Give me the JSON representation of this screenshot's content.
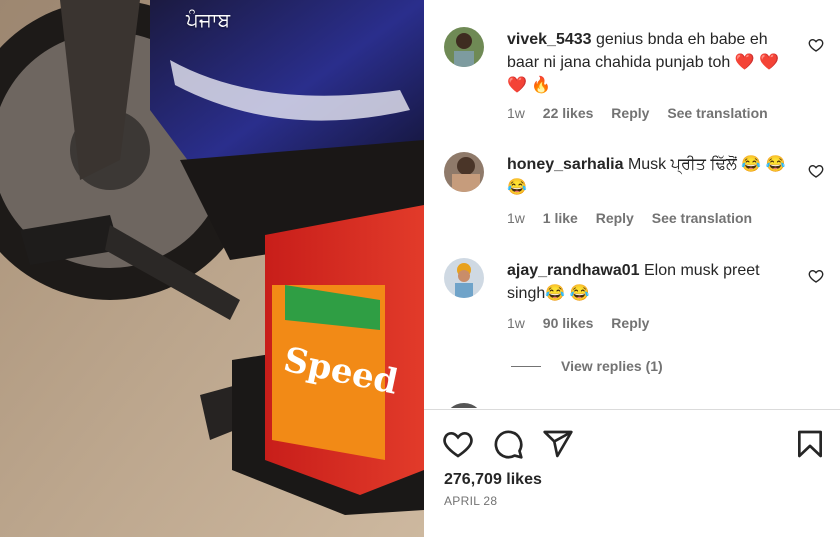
{
  "media": {
    "watermark": "ਪੰਜਾਬ",
    "battery_label": "Speed"
  },
  "comments": [
    {
      "username": "vivek_5433",
      "text": "genius bnda eh babe eh baar ni jana chahida punjab toh ❤️ ❤️ ❤️ 🔥",
      "time": "1w",
      "likes": "22 likes",
      "reply": "Reply",
      "translate": "See translation"
    },
    {
      "username": "honey_sarhalia",
      "text": "Musk ਪ੍ਰੀਤ ਢਿੱਲੋਂ 😂 😂 😂",
      "time": "1w",
      "likes": "1 like",
      "reply": "Reply",
      "translate": "See translation"
    },
    {
      "username": "ajay_randhawa01",
      "text": "Elon musk preet singh😂 😂",
      "time": "1w",
      "likes": "90 likes",
      "reply": "Reply"
    }
  ],
  "view_replies": "View replies (1)",
  "post": {
    "likes": "276,709 likes",
    "date": "APRIL 28"
  },
  "icons": {
    "like": "heart-icon",
    "comment": "comment-icon",
    "share": "share-icon",
    "save": "bookmark-icon"
  },
  "colors": {
    "text": "#262626",
    "secondary": "#737373",
    "heart": "#ed4956",
    "divider": "#dbdbdb"
  }
}
